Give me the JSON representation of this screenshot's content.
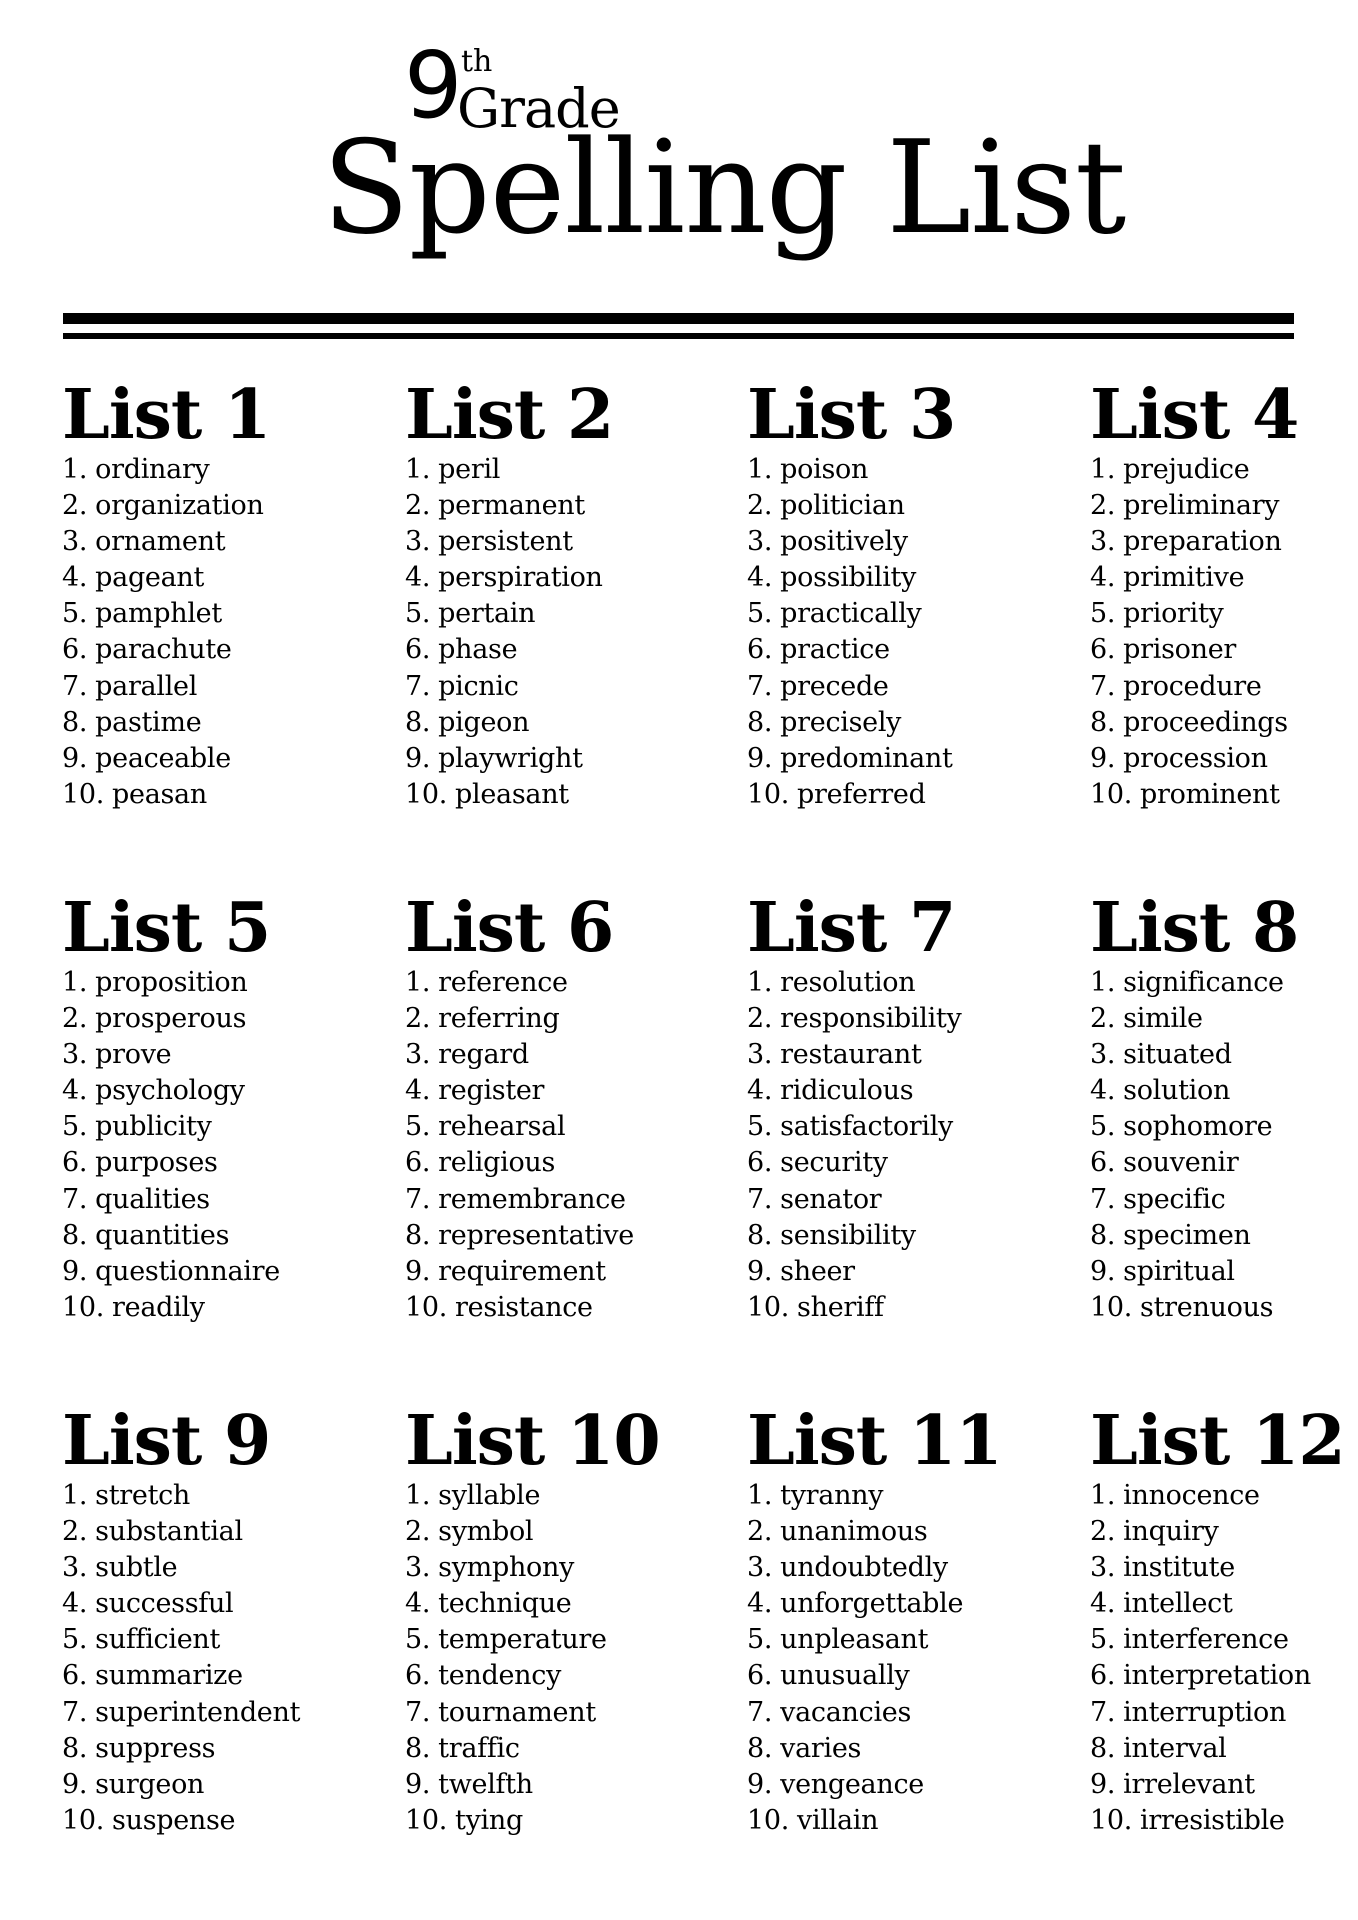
{
  "header": {
    "grade_number": "9",
    "grade_suffix": "th",
    "grade_word": "Grade",
    "title": "Spelling List"
  },
  "lists": [
    {
      "heading": "List 1",
      "words": [
        "ordinary",
        "organization",
        "ornament",
        "pageant",
        "pamphlet",
        "parachute",
        "parallel",
        "pastime",
        "peaceable",
        "peasan"
      ]
    },
    {
      "heading": "List 2",
      "words": [
        "peril",
        "permanent",
        "persistent",
        "perspiration",
        "pertain",
        "phase",
        "picnic",
        "pigeon",
        "playwright",
        "pleasant"
      ]
    },
    {
      "heading": "List 3",
      "words": [
        "poison",
        "politician",
        "positively",
        "possibility",
        "practically",
        "practice",
        "precede",
        "precisely",
        "predominant",
        "preferred"
      ]
    },
    {
      "heading": "List 4",
      "words": [
        "prejudice",
        "preliminary",
        "preparation",
        "primitive",
        "priority",
        "prisoner",
        "procedure",
        "proceedings",
        "procession",
        "prominent"
      ]
    },
    {
      "heading": "List 5",
      "words": [
        "proposition",
        "prosperous",
        "prove",
        "psychology",
        "publicity",
        "purposes",
        "qualities",
        "quantities",
        "questionnaire",
        "readily"
      ]
    },
    {
      "heading": "List 6",
      "words": [
        "reference",
        "referring",
        "regard",
        "register",
        "rehearsal",
        "religious",
        "remembrance",
        "representative",
        "requirement",
        "resistance"
      ]
    },
    {
      "heading": "List 7",
      "words": [
        "resolution",
        "responsibility",
        "restaurant",
        "ridiculous",
        "satisfactorily",
        "security",
        "senator",
        "sensibility",
        "sheer",
        "sheriff"
      ]
    },
    {
      "heading": "List 8",
      "words": [
        "significance",
        "simile",
        "situated",
        "solution",
        "sophomore",
        "souvenir",
        "specific",
        "specimen",
        "spiritual",
        "strenuous"
      ]
    },
    {
      "heading": "List 9",
      "words": [
        "stretch",
        "substantial",
        "subtle",
        "successful",
        "sufficient",
        "summarize",
        "superintendent",
        "suppress",
        "surgeon",
        "suspense"
      ]
    },
    {
      "heading": "List 10",
      "words": [
        "syllable",
        "symbol",
        "symphony",
        "technique",
        "temperature",
        "tendency",
        "tournament",
        "traffic",
        "twelfth",
        "tying"
      ]
    },
    {
      "heading": "List 11",
      "words": [
        "tyranny",
        "unanimous",
        "undoubtedly",
        "unforgettable",
        "unpleasant",
        "unusually",
        "vacancies",
        "varies",
        "vengeance",
        "villain"
      ]
    },
    {
      "heading": "List 12",
      "words": [
        "innocence",
        "inquiry",
        "institute",
        "intellect",
        "interference",
        "interpretation",
        "interruption",
        "interval",
        "irrelevant",
        "irresistible"
      ]
    }
  ]
}
